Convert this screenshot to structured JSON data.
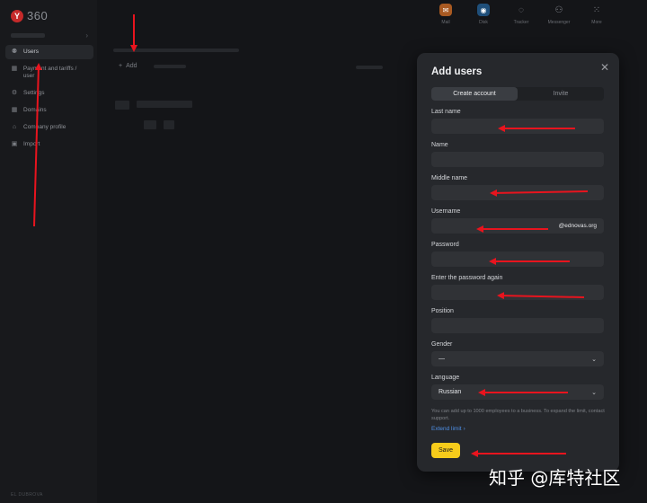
{
  "app": {
    "logo_mark": "Y",
    "logo_text": "360"
  },
  "sidebar": {
    "items": [
      {
        "label": "Users",
        "icon": "user-icon",
        "glyph": "⚉"
      },
      {
        "label": "Payment and tariffs / user",
        "icon": "grid-icon",
        "glyph": "▦"
      },
      {
        "label": "Settings",
        "icon": "gear-icon",
        "glyph": "⚙"
      },
      {
        "label": "Domains",
        "icon": "grid-icon",
        "glyph": "▦"
      },
      {
        "label": "Company profile",
        "icon": "home-icon",
        "glyph": "⌂"
      },
      {
        "label": "Import",
        "icon": "import-icon",
        "glyph": "▣"
      }
    ],
    "footer": "EL DUBROVA"
  },
  "topbar": {
    "apps": [
      {
        "label": "Mail",
        "icon": "mail-icon",
        "glyph": "✉"
      },
      {
        "label": "Disk",
        "icon": "disk-icon",
        "glyph": "◉"
      },
      {
        "label": "Tracker",
        "icon": "tracker-icon",
        "glyph": "◌"
      },
      {
        "label": "Messenger",
        "icon": "messenger-icon",
        "glyph": "⚇"
      },
      {
        "label": "More",
        "icon": "grid-icon",
        "glyph": "⁙"
      }
    ]
  },
  "main": {
    "add_label": "Add"
  },
  "modal": {
    "title": "Add users",
    "tabs": [
      {
        "label": "Create account",
        "active": true
      },
      {
        "label": "Invite",
        "active": false
      }
    ],
    "fields": {
      "last_name": {
        "label": "Last name",
        "value": ""
      },
      "name": {
        "label": "Name",
        "value": ""
      },
      "middle_name": {
        "label": "Middle name",
        "value": ""
      },
      "username": {
        "label": "Username",
        "value": "",
        "suffix": "@ednovas.org"
      },
      "password": {
        "label": "Password",
        "value": ""
      },
      "password_again": {
        "label": "Enter the password again",
        "value": ""
      },
      "position": {
        "label": "Position",
        "value": ""
      },
      "gender": {
        "label": "Gender",
        "value": "—"
      },
      "language": {
        "label": "Language",
        "value": "Russian"
      }
    },
    "hint": "You can add up to 1000 employees to a business. To expand the limit, contact support.",
    "extend_link": "Extend limit",
    "save_label": "Save"
  },
  "colors": {
    "accent": "#f7cc1b",
    "link": "#4e8fe6",
    "annotation": "#e8141e",
    "modal_bg": "#26282c"
  },
  "watermark": "知乎 @库特社区"
}
